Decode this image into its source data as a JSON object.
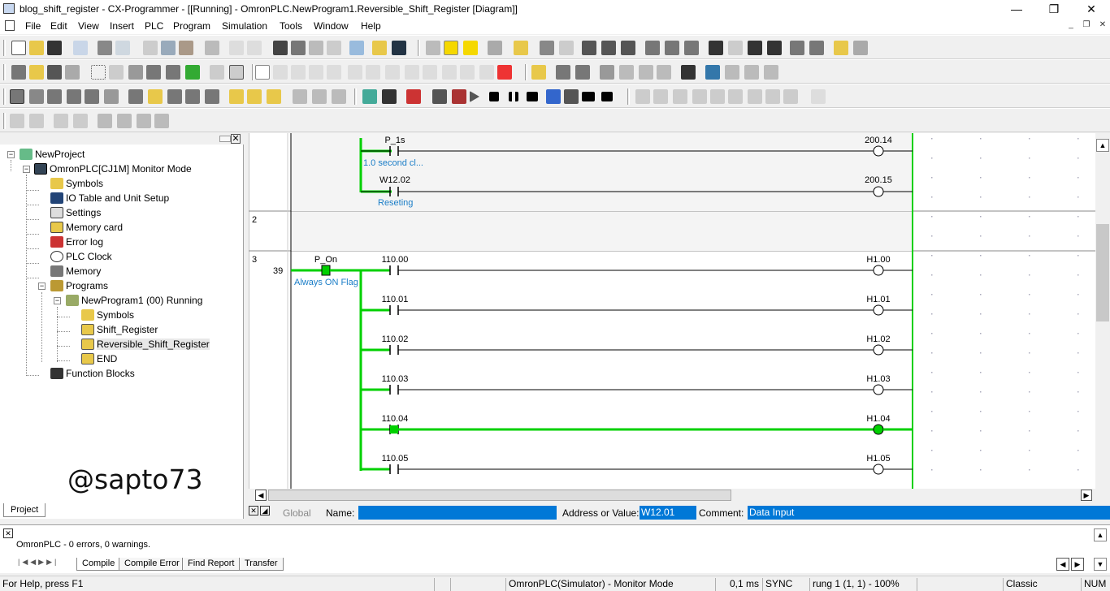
{
  "window": {
    "title": "blog_shift_register - CX-Programmer - [[Running] - OmronPLC.NewProgram1.Reversible_Shift_Register [Diagram]]",
    "minimize": "—",
    "maximize": "❐",
    "close": "✕"
  },
  "menu": [
    "File",
    "Edit",
    "View",
    "Insert",
    "PLC",
    "Program",
    "Simulation",
    "Tools",
    "Window",
    "Help"
  ],
  "project_tree": [
    {
      "label": "NewProject",
      "icon": "project-icon"
    },
    {
      "label": "OmronPLC[CJ1M] Monitor Mode",
      "icon": "plc-icon"
    },
    {
      "label": "Symbols",
      "icon": "symbols-icon"
    },
    {
      "label": "IO Table and Unit Setup",
      "icon": "io-table-icon"
    },
    {
      "label": "Settings",
      "icon": "settings-icon"
    },
    {
      "label": "Memory card",
      "icon": "memory-card-icon"
    },
    {
      "label": "Error log",
      "icon": "error-log-icon"
    },
    {
      "label": "PLC Clock",
      "icon": "clock-icon"
    },
    {
      "label": "Memory",
      "icon": "memory-icon"
    },
    {
      "label": "Programs",
      "icon": "programs-icon"
    },
    {
      "label": "NewProgram1 (00) Running",
      "icon": "program-icon"
    },
    {
      "label": "Symbols",
      "icon": "symbols-icon"
    },
    {
      "label": "Shift_Register",
      "icon": "section-icon"
    },
    {
      "label": "Reversible_Shift_Register",
      "icon": "section-icon"
    },
    {
      "label": "END",
      "icon": "section-icon"
    },
    {
      "label": "Function Blocks",
      "icon": "function-blocks-icon"
    }
  ],
  "watermark": "@sapto73",
  "project_tab": "Project",
  "ladder": {
    "rung1": {
      "contacts": [
        {
          "address": "P_1s",
          "comment": "1.0 second cl...",
          "coil": "200.14",
          "active": false
        },
        {
          "address": "W12.02",
          "comment": "Reseting",
          "coil": "200.15",
          "active": false
        }
      ]
    },
    "rung2": {
      "number": "2"
    },
    "rung3": {
      "number": "3",
      "step": "39",
      "input": {
        "address": "P_On",
        "comment": "Always ON Flag"
      },
      "branches": [
        {
          "address": "110.00",
          "coil": "H1.00",
          "active": false
        },
        {
          "address": "110.01",
          "coil": "H1.01",
          "active": false
        },
        {
          "address": "110.02",
          "coil": "H1.02",
          "active": false
        },
        {
          "address": "110.03",
          "coil": "H1.03",
          "active": false
        },
        {
          "address": "110.04",
          "coil": "H1.04",
          "active": true
        },
        {
          "address": "110.05",
          "coil": "H1.05",
          "active": false
        }
      ]
    }
  },
  "namebar": {
    "global": "Global",
    "name_label": "Name:",
    "name_value": "",
    "address_label": "Address or Value:",
    "address_value": "W12.01",
    "comment_label": "Comment:",
    "comment_value": "Data Input"
  },
  "output": {
    "message": "OmronPLC - 0 errors, 0 warnings.",
    "tabs": [
      "Compile",
      "Compile Error",
      "Find Report",
      "Transfer"
    ]
  },
  "status": {
    "help": "For Help, press F1",
    "mode": "OmronPLC(Simulator) - Monitor Mode",
    "scan": "0,1 ms",
    "sync": "SYNC",
    "position": "rung 1 (1, 1)  - 100%",
    "style": "Classic",
    "num": "NUM"
  },
  "colors": {
    "power_on": "#00d000",
    "wire": "#000000",
    "comment_text": "#1a7dc7",
    "selection": "#0078d7"
  }
}
